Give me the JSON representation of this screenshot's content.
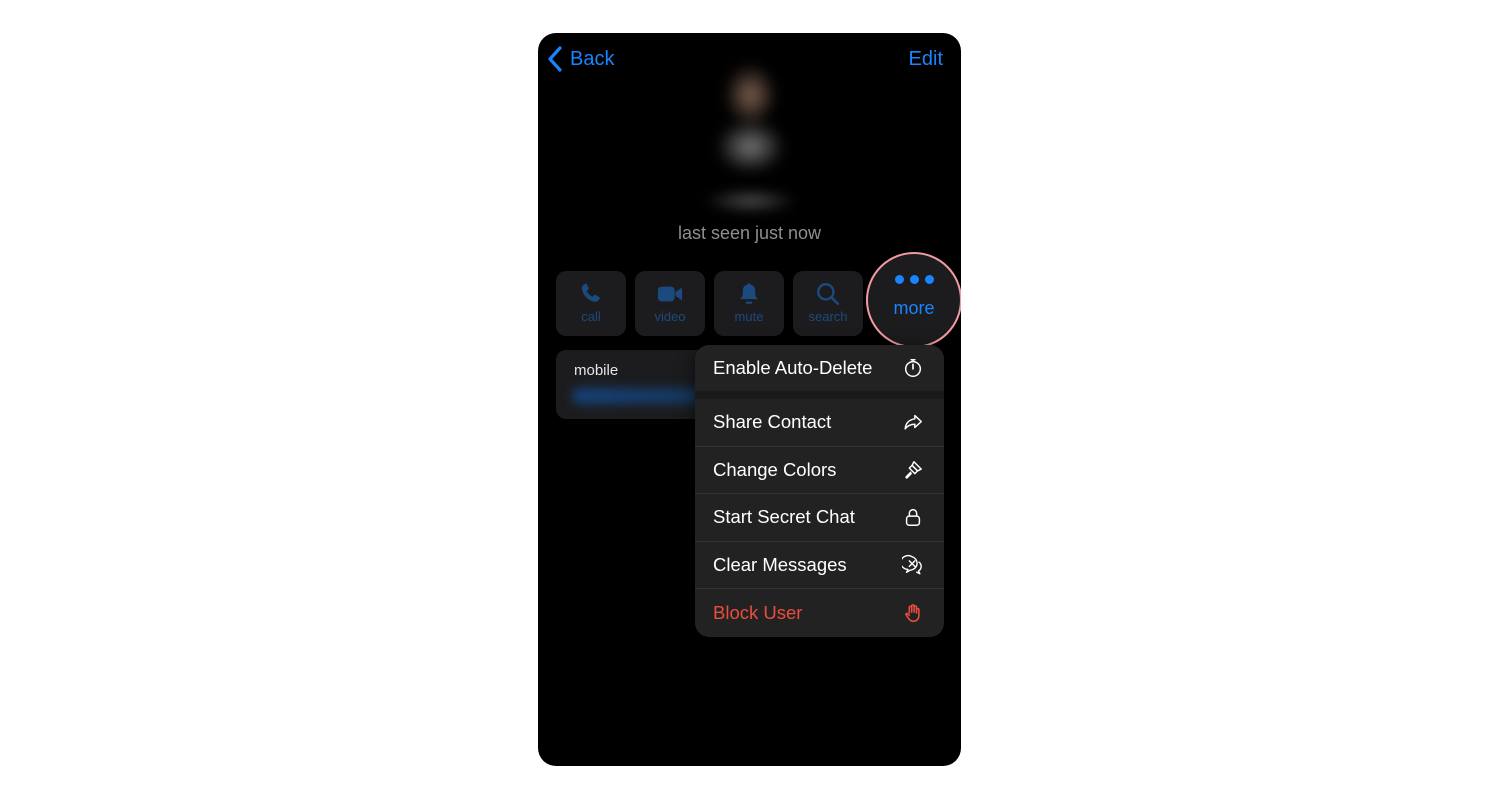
{
  "nav": {
    "back_label": "Back",
    "edit_label": "Edit"
  },
  "profile": {
    "status": "last seen just now"
  },
  "actions": [
    {
      "label": "call",
      "icon": "phone-icon"
    },
    {
      "label": "video",
      "icon": "video-camera-icon"
    },
    {
      "label": "mute",
      "icon": "bell-icon"
    },
    {
      "label": "search",
      "icon": "search-icon"
    }
  ],
  "more": {
    "label": "more",
    "icon": "ellipsis-icon"
  },
  "info": {
    "label": "mobile"
  },
  "menu": {
    "items": [
      {
        "label": "Enable Auto-Delete",
        "icon": "timer-icon"
      },
      {
        "label": "Share Contact",
        "icon": "share-arrow-icon"
      },
      {
        "label": "Change Colors",
        "icon": "paintbrush-icon"
      },
      {
        "label": "Start Secret Chat",
        "icon": "lock-icon"
      },
      {
        "label": "Clear Messages",
        "icon": "clear-chat-icon"
      },
      {
        "label": "Block User",
        "icon": "hand-stop-icon"
      }
    ]
  },
  "colors": {
    "accent": "#1a84ff",
    "danger": "#eb4d3d",
    "highlight_ring": "#f49aa4",
    "background": "#000000",
    "surface": "#1c1c1e"
  }
}
